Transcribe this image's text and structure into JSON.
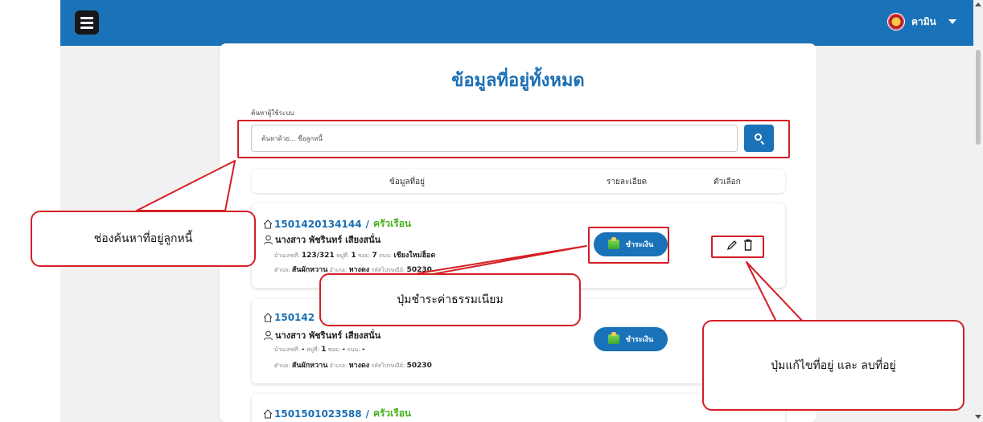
{
  "header": {
    "username": "คามิน"
  },
  "page": {
    "title": "ข้อมูลที่อยู่ทั้งหมด"
  },
  "search": {
    "label": "ค้นหาผู้ใช้ระบบ",
    "placeholder": "ค้นหาด้วย... ชื่อลูกหนี้"
  },
  "table": {
    "columns": [
      "ข้อมูลที่อยู่",
      "รายละเอียด",
      "ตัวเลือก"
    ]
  },
  "records": [
    {
      "id": "1501420134144",
      "tag": "ครัวเรือน",
      "name": "นางสาว พัชรินทร์ เสียงสนั่น",
      "line1": {
        "house_label": "บ้านเลขที่:",
        "house": "123/321",
        "moo_label": "หมู่ที่:",
        "moo": "1",
        "soi_label": "ซอย:",
        "soi": "7",
        "road_label": "ถนน:",
        "road": "เชียงใหม่ฮ็อด"
      },
      "line2": {
        "tambon_label": "ตำบล:",
        "tambon": "สันผักหวาน",
        "amphoe_label": "อำเภอ:",
        "amphoe": "หางดง",
        "zip_label": "รหัสไปรษณีย์:",
        "zip": "50230"
      },
      "pay_label": "ชำระเงิน"
    },
    {
      "id": "150142",
      "tag": "",
      "name": "นางสาว พัชรินทร์ เสียงสนั่น",
      "line1": {
        "house_label": "บ้านเลขที่:",
        "house": "-",
        "moo_label": "หมู่ที่:",
        "moo": "1",
        "soi_label": "ซอย:",
        "soi": "-",
        "road_label": "ถนน:",
        "road": "-"
      },
      "line2": {
        "tambon_label": "ตำบล:",
        "tambon": "สันผักหวาน",
        "amphoe_label": "อำเภอ:",
        "amphoe": "หางดง",
        "zip_label": "รหัสไปรษณีย์:",
        "zip": "50230"
      },
      "pay_label": "ชำระเงิน"
    },
    {
      "id": "1501501023588",
      "tag": "ครัวเรือน"
    }
  ],
  "annotations": {
    "search": "ช่องค้นหาที่อยู่ลูกหนี้",
    "pay": "ปุ่มชำระค่าธรรมเนียม",
    "edit_delete": "ปุ่มแก้ไขที่อยู่ และ ลบที่อยู่"
  },
  "colors": {
    "header": "#1a73b8",
    "title": "#1a6fb5",
    "tag": "#47b11c",
    "annotation": "#d41f26"
  },
  "icons": [
    "menu-icon",
    "user-avatar",
    "chevron-down-icon",
    "search-icon",
    "house-icon",
    "person-icon",
    "payment-icon",
    "edit-icon",
    "delete-icon"
  ]
}
